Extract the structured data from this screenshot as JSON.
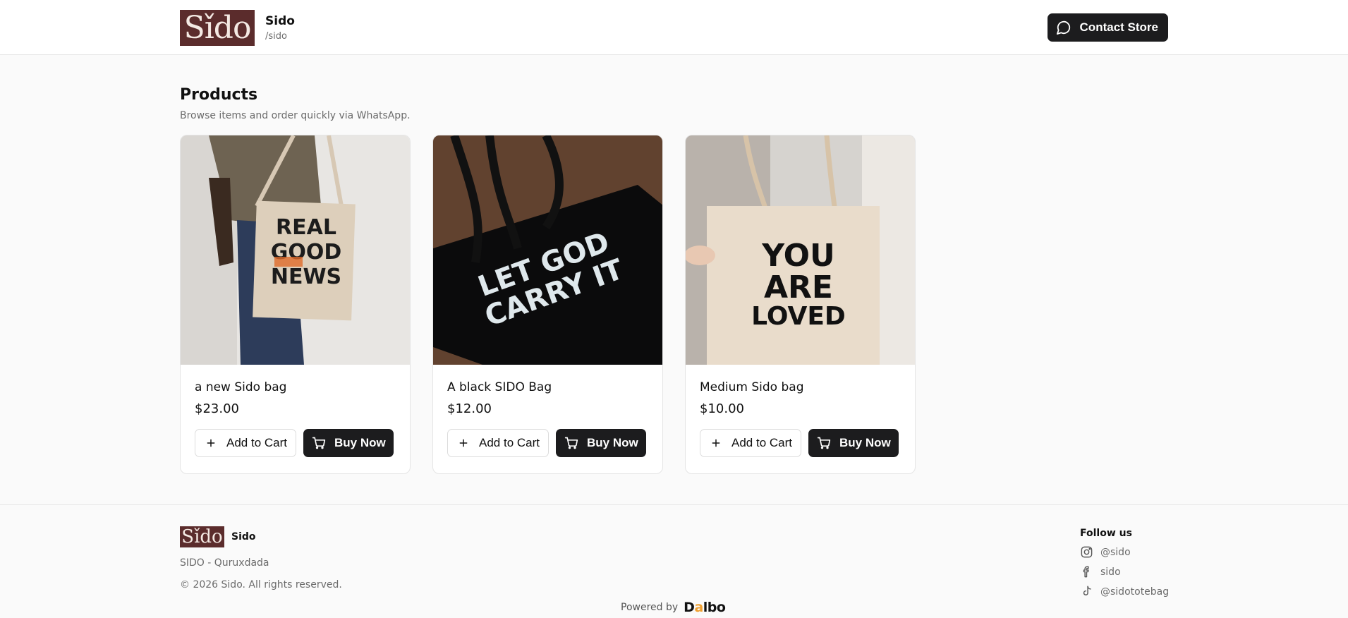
{
  "header": {
    "logo_text": "Sǐdo",
    "store_name": "Sido",
    "store_slug": "/sido",
    "contact_label": "Contact Store"
  },
  "section": {
    "title": "Products",
    "subtitle": "Browse items and order quickly via WhatsApp."
  },
  "products": [
    {
      "name": "a new Sido bag",
      "price": "$23.00",
      "image_text": [
        "REAL",
        "GOOD",
        "NEWS"
      ]
    },
    {
      "name": "A black SIDO Bag",
      "price": "$12.00",
      "image_text": [
        "LET GOD",
        "CARRY IT"
      ]
    },
    {
      "name": "Medium Sido bag",
      "price": "$10.00",
      "image_text": [
        "YOU",
        "ARE",
        "LOVED"
      ]
    }
  ],
  "buttons": {
    "add_to_cart": "Add to Cart",
    "buy_now": "Buy Now"
  },
  "footer": {
    "logo_text": "Sǐdo",
    "store_name": "Sido",
    "tagline": "SIDO - Quruxdada",
    "copyright": "© 2026 Sido. All rights reserved.",
    "follow_title": "Follow us",
    "socials": [
      {
        "icon": "instagram-icon",
        "label": "@sido"
      },
      {
        "icon": "facebook-icon",
        "label": "sido"
      },
      {
        "icon": "tiktok-icon",
        "label": "@sidototebag"
      }
    ],
    "powered_by": "Powered by",
    "powered_brand": "Dalbo"
  },
  "colors": {
    "brand": "#5b2c2c",
    "button_dark": "#1c1c1e",
    "accent": "#f0a030"
  }
}
